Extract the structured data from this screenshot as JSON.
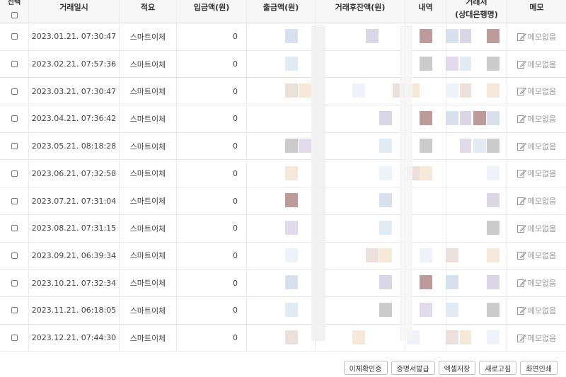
{
  "table": {
    "headers": {
      "select": "선택",
      "date": "거래일시",
      "summary": "적요",
      "deposit": "입금액(원)",
      "withdrawal": "출금액(원)",
      "balance": "거래후잔액(원)",
      "detail": "내역",
      "counterpart_top": "거래처",
      "counterpart": "(상대은행명)",
      "memo": "메모"
    },
    "rows": [
      {
        "date": "2023.01.21. 07:30:47",
        "summary": "스마트이체",
        "deposit": "0",
        "memo": "메모없음"
      },
      {
        "date": "2023.02.21. 07:57:36",
        "summary": "스마트이체",
        "deposit": "0",
        "memo": "메모없음"
      },
      {
        "date": "2023.03.21. 07:30:47",
        "summary": "스마트이체",
        "deposit": "0",
        "memo": "메모없음"
      },
      {
        "date": "2023.04.21. 07:36:42",
        "summary": "스마트이체",
        "deposit": "0",
        "memo": "메모없음"
      },
      {
        "date": "2023.05.21. 08:18:28",
        "summary": "스마트이체",
        "deposit": "0",
        "memo": "메모없음"
      },
      {
        "date": "2023.06.21. 07:32:58",
        "summary": "스마트이체",
        "deposit": "0",
        "memo": "메모없음"
      },
      {
        "date": "2023.07.21. 07:31:04",
        "summary": "스마트이체",
        "deposit": "0",
        "memo": "메모없음"
      },
      {
        "date": "2023.08.21. 07:31:15",
        "summary": "스마트이체",
        "deposit": "0",
        "memo": "메모없음"
      },
      {
        "date": "2023.09.21. 06:39:34",
        "summary": "스마트이체",
        "deposit": "0",
        "memo": "메모없음"
      },
      {
        "date": "2023.10.21. 07:32:34",
        "summary": "스마트이체",
        "deposit": "0",
        "memo": "메모없음"
      },
      {
        "date": "2023.11.21. 06:18:05",
        "summary": "스마트이체",
        "deposit": "0",
        "memo": "메모없음"
      },
      {
        "date": "2023.12.21. 07:44:30",
        "summary": "스마트이체",
        "deposit": "0",
        "memo": "메모없음"
      }
    ]
  },
  "toolbar": {
    "buttons": [
      "이체확인증",
      "증명서발급",
      "엑셀저장",
      "새로고침",
      "화면인쇄"
    ]
  },
  "redaction_colors": [
    "#c9d5e6",
    "#d8e4f0",
    "#e6d5d0",
    "#cfc8dc",
    "#b9b9b9",
    "#f3e1cc",
    "#a77a78",
    "#d7cde3",
    "#e9eef5"
  ]
}
